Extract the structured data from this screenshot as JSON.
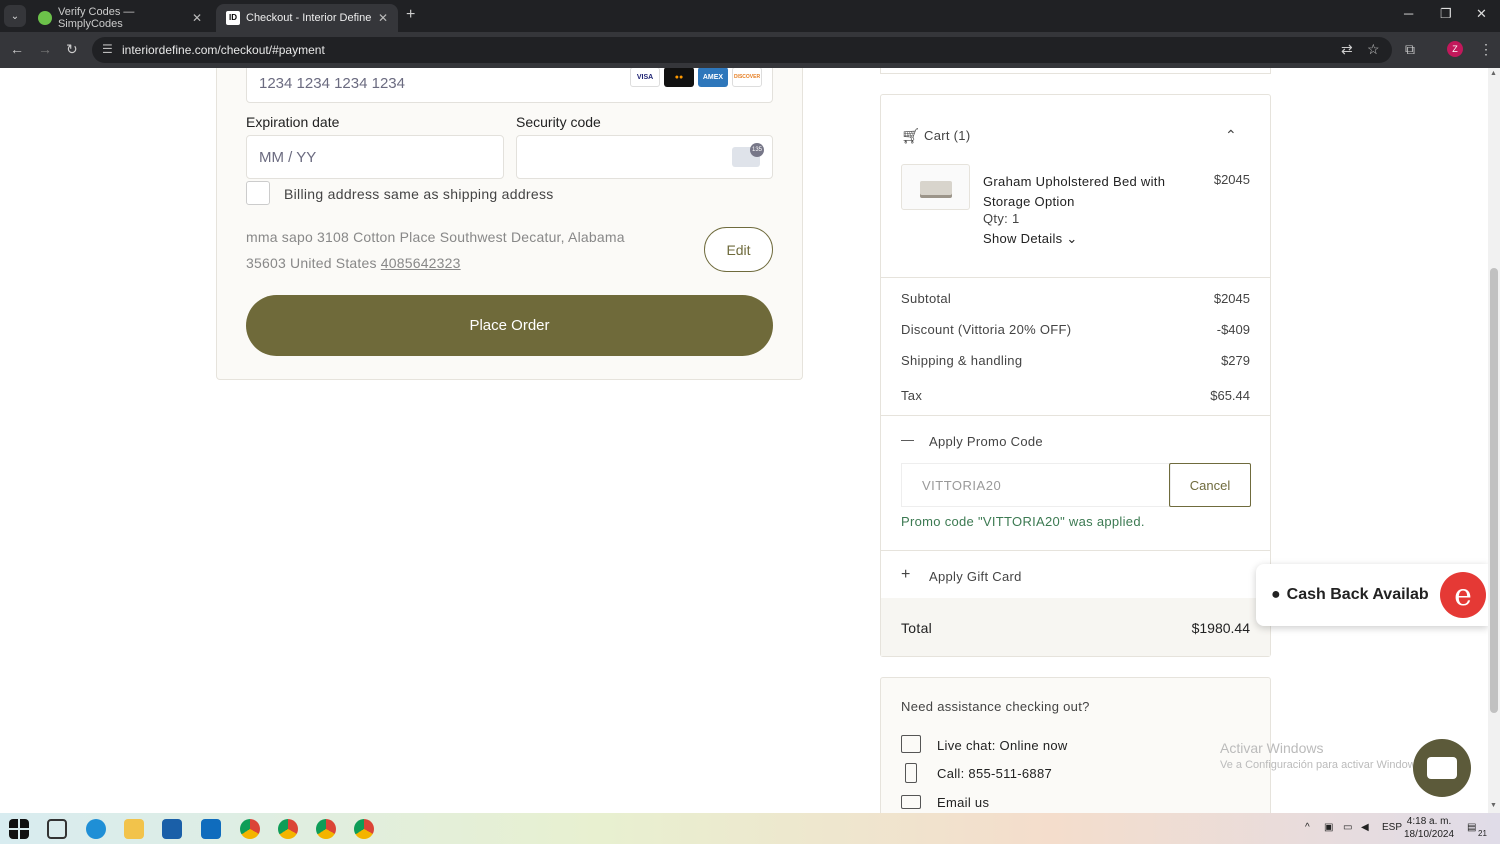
{
  "browser": {
    "tabs": [
      {
        "title": "Verify Codes — SimplyCodes",
        "active": false
      },
      {
        "title": "Checkout - Interior Define",
        "active": true
      }
    ],
    "url": "interiordefine.com/checkout/#payment",
    "profile_initial": "Z"
  },
  "payment": {
    "card_placeholder": "1234 1234 1234 1234",
    "card_brands": [
      "VISA",
      "MC",
      "AMEX",
      "DISCOVER"
    ],
    "expiration_label": "Expiration date",
    "expiration_placeholder": "MM / YY",
    "security_label": "Security code",
    "cvc_badge": "135",
    "billing_same_label": "Billing address same as shipping address",
    "address": "mma sapo 3108 Cotton Place Southwest Decatur, Alabama 35603 United States",
    "phone": "4085642323",
    "edit_label": "Edit",
    "place_order_label": "Place Order"
  },
  "cart": {
    "title": "Cart (1)",
    "item": {
      "name": "Graham Upholstered Bed with Storage Option",
      "price": "$2045",
      "qty": "Qty: 1",
      "details_label": "Show Details"
    },
    "subtotal_label": "Subtotal",
    "subtotal": "$2045",
    "discount_label": "Discount (Vittoria 20% OFF)",
    "discount": "-$409",
    "shipping_label": "Shipping & handling",
    "shipping": "$279",
    "tax_label": "Tax",
    "tax": "$65.44",
    "promo_label": "Apply Promo Code",
    "promo_value": "VITTORIA20",
    "cancel_label": "Cancel",
    "promo_msg": "Promo code \"VITTORIA20\" was applied.",
    "gift_label": "Apply Gift Card",
    "total_label": "Total",
    "total": "$1980.44"
  },
  "help": {
    "title": "Need assistance checking out?",
    "chat": "Live chat: Online now",
    "call": "Call: 855-511-6887",
    "email": "Email us"
  },
  "overlay": {
    "cashback": "Cash Back Availab",
    "watermark_title": "Activar Windows",
    "watermark_sub": "Ve a Configuración para activar Windows."
  },
  "taskbar": {
    "lang": "ESP",
    "time": "4:18 a. m.",
    "date": "18/10/2024",
    "notif_count": "21"
  }
}
